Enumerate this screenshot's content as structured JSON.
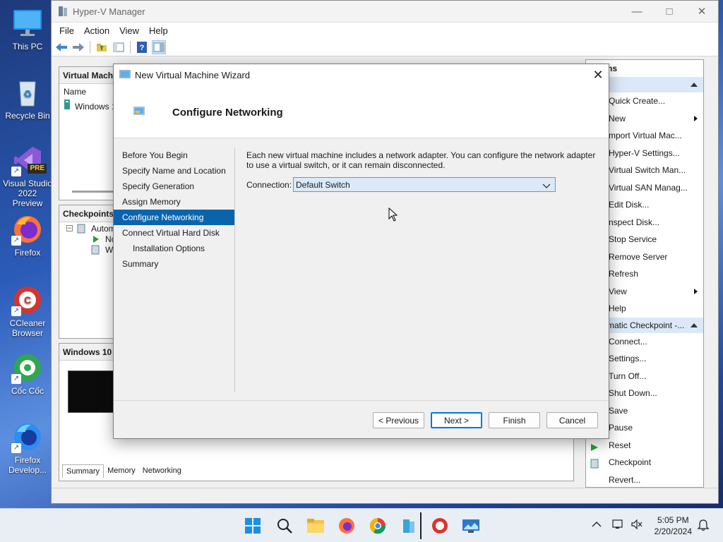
{
  "desktop": {
    "icons": [
      {
        "label": "This PC"
      },
      {
        "label": "Recycle Bin"
      },
      {
        "label": "Visual Studio 2022 Preview",
        "badge": "PRE"
      },
      {
        "label": "Firefox"
      },
      {
        "label": "CCleaner Browser"
      },
      {
        "label": "Cốc Cốc"
      },
      {
        "label": "Firefox Develop..."
      }
    ]
  },
  "hyperv": {
    "title": "Hyper-V Manager",
    "menu": [
      "File",
      "Action",
      "View",
      "Help"
    ],
    "vm_panel": {
      "title": "Virtual Machi",
      "column_name": "Name",
      "row": "Windows 10"
    },
    "checkpoints_panel": {
      "title": "Checkpoints",
      "root": "Automa",
      "child1": "No",
      "child2": "Wi"
    },
    "details_panel": {
      "title": "Windows 10",
      "tabs": [
        "Summary",
        "Memory",
        "Networking"
      ]
    },
    "actions": {
      "title": "ns",
      "group1_items": [
        {
          "label": "Quick Create...",
          "sub": false
        },
        {
          "label": "New",
          "sub": true
        },
        {
          "label": "mport Virtual Mac...",
          "sub": false
        },
        {
          "label": "Hyper-V Settings...",
          "sub": false
        },
        {
          "label": "Virtual Switch Man...",
          "sub": false
        },
        {
          "label": "Virtual SAN Manag...",
          "sub": false
        },
        {
          "label": "Edit Disk...",
          "sub": false
        },
        {
          "label": "nspect Disk...",
          "sub": false
        },
        {
          "label": "Stop Service",
          "sub": false
        },
        {
          "label": "Remove Server",
          "sub": false
        },
        {
          "label": "Refresh",
          "sub": false
        },
        {
          "label": "View",
          "sub": true
        },
        {
          "label": "Help",
          "sub": false
        }
      ],
      "group2_title": "matic Checkpoint -...",
      "group2_items": [
        {
          "label": "Connect..."
        },
        {
          "label": "Settings..."
        },
        {
          "label": "Turn Off..."
        },
        {
          "label": "Shut Down..."
        },
        {
          "label": "Save"
        },
        {
          "label": "Pause"
        },
        {
          "label": "Reset"
        },
        {
          "label": "Checkpoint"
        },
        {
          "label": "Revert..."
        }
      ]
    }
  },
  "wizard": {
    "title": "New Virtual Machine Wizard",
    "heading": "Configure Networking",
    "steps": [
      {
        "label": "Before You Begin",
        "sub": false,
        "selected": false
      },
      {
        "label": "Specify Name and Location",
        "sub": false,
        "selected": false
      },
      {
        "label": "Specify Generation",
        "sub": false,
        "selected": false
      },
      {
        "label": "Assign Memory",
        "sub": false,
        "selected": false
      },
      {
        "label": "Configure Networking",
        "sub": false,
        "selected": true
      },
      {
        "label": "Connect Virtual Hard Disk",
        "sub": false,
        "selected": false
      },
      {
        "label": "Installation Options",
        "sub": true,
        "selected": false
      },
      {
        "label": "Summary",
        "sub": false,
        "selected": false
      }
    ],
    "description": "Each new virtual machine includes a network adapter. You can configure the network adapter to use a virtual switch, or it can remain disconnected.",
    "connection_label": "Connection:",
    "connection_value": "Default Switch",
    "buttons": {
      "previous": "< Previous",
      "next": "Next >",
      "finish": "Finish",
      "cancel": "Cancel"
    }
  },
  "taskbar": {
    "time": "5:05 PM",
    "date": "2/20/2024"
  },
  "colors": {
    "selection": "#0a64ad",
    "accent": "#0078d4",
    "actions_group": "#dbe8f7"
  }
}
